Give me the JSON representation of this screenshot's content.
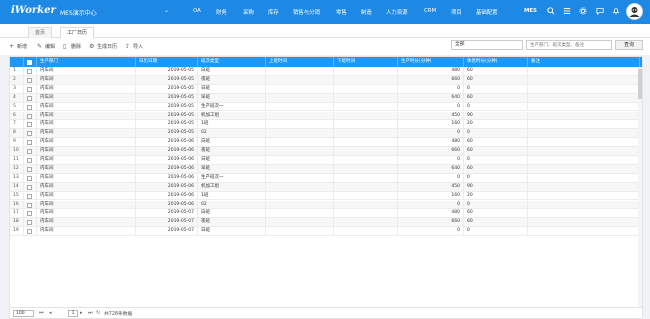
{
  "header": {
    "logo": "iWorker",
    "system": "MES演示中心",
    "nav": [
      "OA",
      "财务",
      "采购",
      "库存",
      "销售与分销",
      "零售",
      "制造",
      "人力资源",
      "CRM",
      "项目",
      "基础配置"
    ],
    "mes": "MES"
  },
  "tabs": [
    "首页",
    "工厂日历"
  ],
  "toolbar": {
    "buttons": [
      "新增",
      "编辑",
      "删除",
      "生成日历",
      "导入"
    ],
    "filter_value": "全部",
    "search_placeholder": "生产部门、班次类型、备注",
    "query_label": "查询"
  },
  "table": {
    "columns": [
      "生产部门",
      "日历日期",
      "班次类型",
      "上班时间",
      "下班时间",
      "生产时长(分钟)",
      "休息时长(分钟)",
      "备注"
    ],
    "rows": [
      [
        "1",
        "内车间",
        "2019-05-05",
        "白班",
        "",
        "",
        "480",
        "60",
        ""
      ],
      [
        "2",
        "内车间",
        "2019-05-05",
        "夜班",
        "",
        "",
        "660",
        "60",
        ""
      ],
      [
        "3",
        "内车间",
        "2019-05-05",
        "日班",
        "",
        "",
        "0",
        "0",
        ""
      ],
      [
        "4",
        "内车间",
        "2019-05-05",
        "早班",
        "",
        "",
        "640",
        "60",
        ""
      ],
      [
        "5",
        "内车间",
        "2019-05-05",
        "生产班次一",
        "",
        "",
        "0",
        "0",
        ""
      ],
      [
        "6",
        "内车间",
        "2019-05-05",
        "机加工组",
        "",
        "",
        "450",
        "90",
        ""
      ],
      [
        "7",
        "内车间",
        "2019-05-05",
        "1班",
        "",
        "",
        "160",
        "20",
        ""
      ],
      [
        "8",
        "内车间",
        "2019-05-05",
        "02",
        "",
        "",
        "0",
        "0",
        ""
      ],
      [
        "9",
        "内车间",
        "2019-05-06",
        "白班",
        "",
        "",
        "480",
        "60",
        ""
      ],
      [
        "10",
        "内车间",
        "2019-05-06",
        "夜班",
        "",
        "",
        "660",
        "60",
        ""
      ],
      [
        "11",
        "内车间",
        "2019-05-06",
        "日班",
        "",
        "",
        "0",
        "0",
        ""
      ],
      [
        "12",
        "内车间",
        "2019-05-06",
        "早班",
        "",
        "",
        "640",
        "60",
        ""
      ],
      [
        "13",
        "内车间",
        "2019-05-06",
        "生产班次一",
        "",
        "",
        "0",
        "0",
        ""
      ],
      [
        "14",
        "内车间",
        "2019-05-06",
        "机加工组",
        "",
        "",
        "450",
        "90",
        ""
      ],
      [
        "15",
        "内车间",
        "2019-05-06",
        "1班",
        "",
        "",
        "160",
        "20",
        ""
      ],
      [
        "16",
        "内车间",
        "2019-05-06",
        "02",
        "",
        "",
        "0",
        "0",
        ""
      ],
      [
        "17",
        "内车间",
        "2019-05-07",
        "白班",
        "",
        "",
        "480",
        "60",
        ""
      ],
      [
        "18",
        "内车间",
        "2019-05-07",
        "夜班",
        "",
        "",
        "660",
        "60",
        ""
      ],
      [
        "19",
        "内车间",
        "2019-05-07",
        "日班",
        "",
        "",
        "0",
        "0",
        ""
      ]
    ]
  },
  "pager": {
    "page_size": "100",
    "current_page": "1",
    "total_text": "共728条数据"
  }
}
